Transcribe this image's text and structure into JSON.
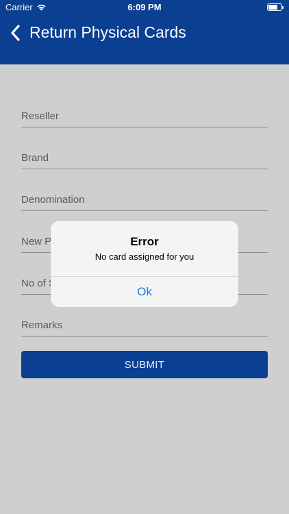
{
  "status_bar": {
    "carrier": "Carrier",
    "time": "6:09 PM",
    "battery_level": 0.7
  },
  "nav": {
    "title": "Return Physical Cards"
  },
  "form": {
    "fields": [
      {
        "label": "Reseller"
      },
      {
        "label": "Brand"
      },
      {
        "label": "Denomination"
      },
      {
        "label": "New P"
      },
      {
        "label": "No of S"
      },
      {
        "label": "Remarks"
      }
    ],
    "submit_label": "SUBMIT"
  },
  "alert": {
    "title": "Error",
    "message": "No card assigned for you",
    "ok_label": "Ok"
  },
  "colors": {
    "header_bg": "#0b3f91",
    "page_bg": "#cfcfcf",
    "link_blue": "#1a7fe6"
  }
}
